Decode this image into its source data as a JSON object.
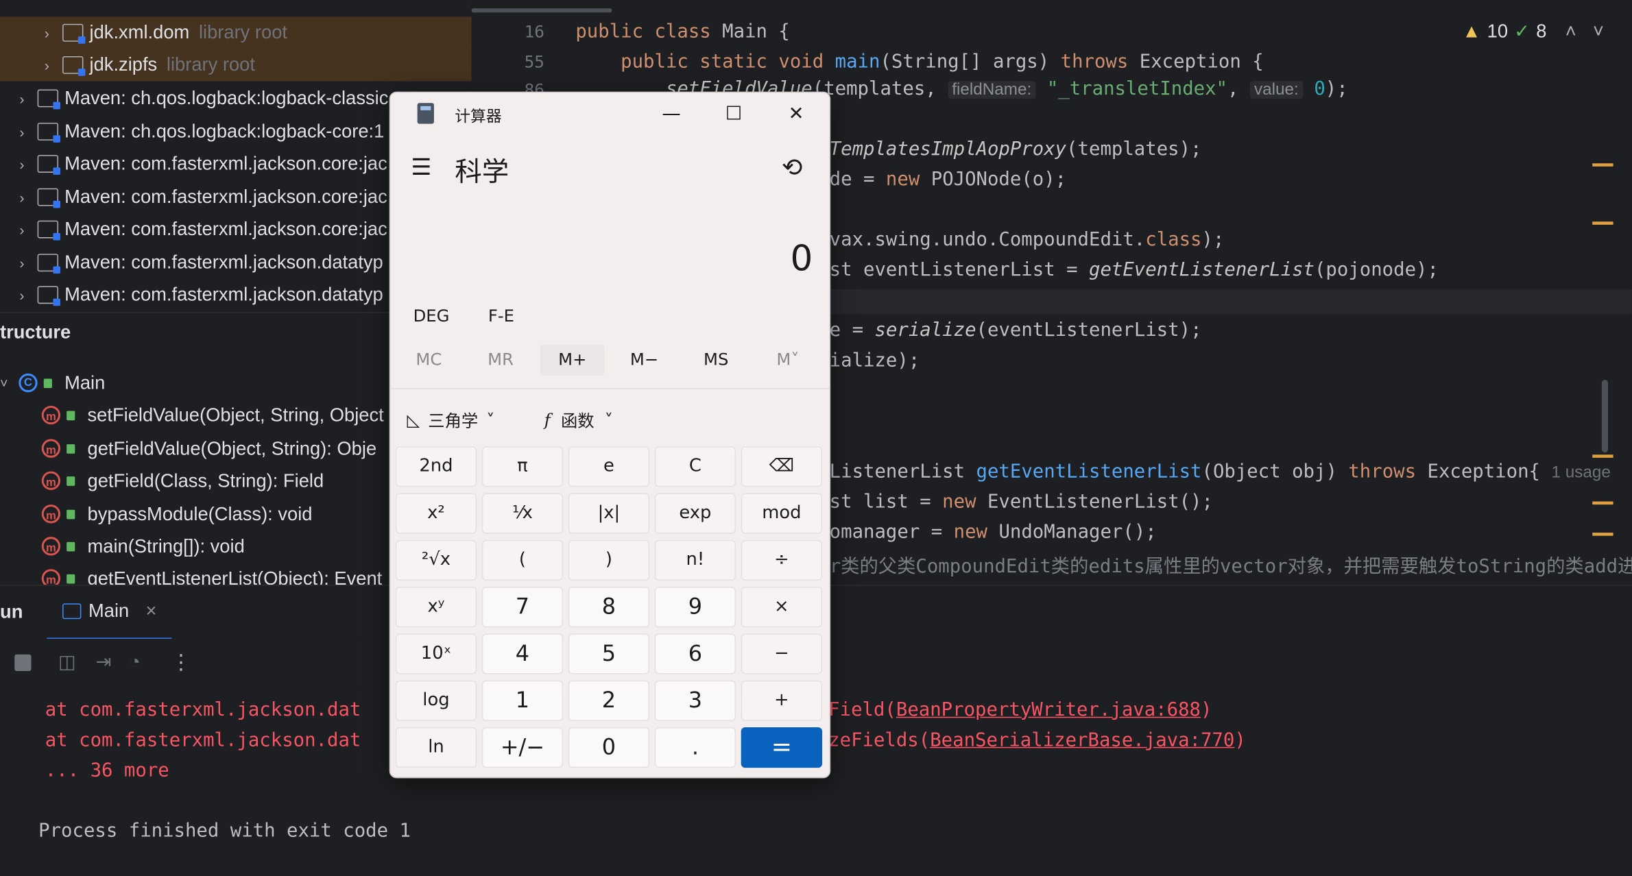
{
  "project_tree": [
    {
      "name": "jdk.xml.dom",
      "tag": "library root"
    },
    {
      "name": "jdk.zipfs",
      "tag": "library root"
    },
    {
      "name": "Maven: ch.qos.logback:logback-classic",
      "tag": ""
    },
    {
      "name": "Maven: ch.qos.logback:logback-core:1",
      "tag": ""
    },
    {
      "name": "Maven: com.fasterxml.jackson.core:jac",
      "tag": ""
    },
    {
      "name": "Maven: com.fasterxml.jackson.core:jac",
      "tag": ""
    },
    {
      "name": "Maven: com.fasterxml.jackson.core:jac",
      "tag": ""
    },
    {
      "name": "Maven: com.fasterxml.jackson.datatyp",
      "tag": ""
    },
    {
      "name": "Maven: com.fasterxml.jackson.datatyp",
      "tag": ""
    }
  ],
  "structure": {
    "title": "tructure",
    "root": "Main",
    "members": [
      "setFieldValue(Object, String, Object",
      "getFieldValue(Object, String): Obje",
      "getField(Class, String): Field",
      "bypassModule(Class): void",
      "main(String[]): void",
      "getEventListenerList(Object): Event"
    ]
  },
  "editor": {
    "inspection": {
      "warnings": "10",
      "ok": "8"
    },
    "line_numbers": [
      "16",
      "55",
      "86"
    ],
    "line1": {
      "a": "public class ",
      "b": "Main {"
    },
    "line2": {
      "a": "    public static void ",
      "b": "main",
      "c": "(String[] args) ",
      "d": "throws ",
      "e": "Exception {"
    },
    "line3": {
      "a": "        setFieldValue",
      "b": "(templates, ",
      "h1": "fieldName:",
      "s": "\"_transletIndex\"",
      "c": ", ",
      "h2": "value:",
      "n": "0",
      "d": ");"
    },
    "line4": {
      "a": "TemplatesImplAopProxy",
      "b": "(templates);"
    },
    "line5": {
      "a": "de = ",
      "b": "new ",
      "c": "POJONode(o);"
    },
    "line6": {
      "a": "vax.swing.undo.CompoundEdit.",
      "b": "class",
      "c": ");"
    },
    "line7": {
      "a": "st eventListenerList = ",
      "b": "getEventListenerList",
      "c": "(pojonode);"
    },
    "line8": {
      "a": "e = ",
      "b": "serialize",
      "c": "(eventListenerList);"
    },
    "line9": {
      "a": "ialize);"
    },
    "line10": {
      "a": "ListenerList ",
      "b": "getEventListenerList",
      "c": "(Object obj) ",
      "d": "throws ",
      "e": "Exception{",
      "usage": "1 usage"
    },
    "line11": {
      "a": "st list = ",
      "b": "new ",
      "c": "EventListenerList();"
    },
    "line12": {
      "a": "omanager = ",
      "b": "new ",
      "c": "UndoManager();"
    },
    "line13": {
      "a": "r类的父类CompoundEdit类的edits属性里的vector对象，并把需要触发toString的类add进去"
    }
  },
  "run": {
    "title": "un",
    "tab": "Main",
    "console": [
      {
        "left": "    at com.fasterxml.jackson.dat",
        "mid": "Field(",
        "link": "BeanPropertyWriter.java:688",
        "end": ")"
      },
      {
        "left": "    at com.fasterxml.jackson.dat",
        "mid": "zeFields(",
        "link": "BeanSerializerBase.java:770",
        "end": ")"
      },
      {
        "left": "    ... 36 more",
        "mid": "",
        "link": "",
        "end": ""
      }
    ],
    "exit": "Process finished with exit code 1"
  },
  "calculator": {
    "title": "计算器",
    "mode": "科学",
    "display": "0",
    "angle": "DEG",
    "fe": "F-E",
    "memory": [
      "MC",
      "MR",
      "M+",
      "M−",
      "MS",
      "M˅"
    ],
    "trig": "三角学",
    "func": "函数",
    "keys": [
      [
        "2nd",
        "π",
        "e",
        "C",
        "⌫"
      ],
      [
        "x²",
        "¹⁄x",
        "|x|",
        "exp",
        "mod"
      ],
      [
        "²√x",
        "(",
        ")",
        "n!",
        "÷"
      ],
      [
        "xʸ",
        "7",
        "8",
        "9",
        "×"
      ],
      [
        "10ˣ",
        "4",
        "5",
        "6",
        "−"
      ],
      [
        "log",
        "1",
        "2",
        "3",
        "+"
      ],
      [
        "ln",
        "+/−",
        "0",
        ".",
        "="
      ]
    ]
  }
}
